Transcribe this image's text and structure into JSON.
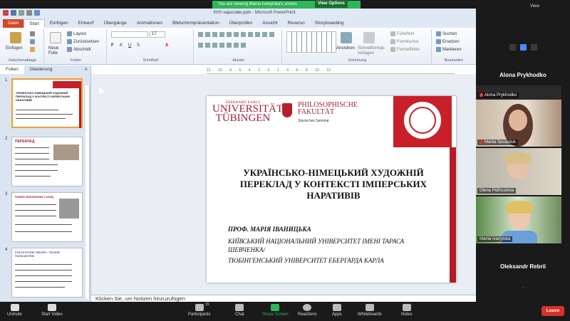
{
  "zoom": {
    "banner": "You are viewing Mariia Ivanytska's screen",
    "view_options": "View Options",
    "view": "View",
    "leave": "Leave",
    "toolbar": {
      "unmute": "Unmute",
      "start_video": "Start Video",
      "participants": "Participants",
      "participants_count": "15",
      "chat": "Chat",
      "share": "Share Screen",
      "reactions": "Reactions",
      "apps": "Apps",
      "whiteboards": "Whiteboards",
      "notes": "Notes"
    },
    "participants": {
      "header_name": "Alona Prykhodko",
      "tiles": [
        "Alona Prykhodko",
        "Mariia Sevastiuk",
        "Olena Pidhrushna",
        "Mariia Ivanytska"
      ],
      "footer_name": "Oleksandr Rebrii"
    }
  },
  "ppt": {
    "title": "КНУ-наративи.pptx - Microsoft PowerPoint",
    "tabs": [
      "Datei",
      "Start",
      "Einfügen",
      "Entwurf",
      "Übergänge",
      "Animationen",
      "Bildschirmpräsentation",
      "Überprüfen",
      "Ansicht",
      "Reverso",
      "Storyboarding"
    ],
    "ribbon": {
      "paste": "Einfügen",
      "clipboard": "Zwischenablage",
      "new_slide": "Neue\nFolie",
      "layout": "Layout",
      "reset": "Zurücksetzen",
      "section": "Abschnitt",
      "slides": "Folien",
      "font_size": "17",
      "font_group": "Schriftart",
      "paragraph": "Absatz",
      "arrange": "Anordnen",
      "quick_styles": "Schnellformat-\nvorlagen",
      "drawing": "Zeichnung",
      "fill": "Fülleffekt",
      "outline": "Formkontur",
      "effects": "Formeffekte",
      "find": "Suchen",
      "replace": "Ersetzen",
      "select": "Markieren",
      "editing": "Bearbeiten"
    },
    "pane_tabs": [
      "Folien",
      "Gliederung"
    ],
    "thumbs": [
      {
        "num": "1",
        "title": "УКРАЇНСЬКО-НІМЕЦЬКИЙ ХУДОЖНІЙ ПЕРЕКЛАД У КОНТЕКСТІ ІМПЕРСЬКИХ НАРАТИВІВ"
      },
      {
        "num": "2",
        "title": "ПЕРЕКЛАД"
      },
      {
        "num": "3",
        "title": "ПАВЛЕ ВИЕЛЬЕНКЕ (*1939)"
      },
      {
        "num": "4",
        "title": "POLYSYSTEM THEORY / ТЕОРІЯ ПОЛІСИСТЕМ"
      }
    ],
    "notes": "Klicken Sie, um Notizen hinzuzufügen",
    "slide": {
      "logo_small": "EBERHARD KARLS",
      "logo_big": "UNIVERSITÄT\nTÜBINGEN",
      "faculty": "PHILOSOPHISCHE\nFAKULTÄT",
      "seminar": "Slavisches Seminar",
      "title": "УКРАЇНСЬКО-НІМЕЦЬКИЙ ХУДОЖНІЙ ПЕРЕКЛАД У КОНТЕКСТІ ІМПЕРСЬКИХ НАРАТИВІВ",
      "author": "ПРОФ. МАРІЯ ІВАНИЦЬКА",
      "affil1": "КИЇВСЬКИЙ НАЦІОНАЛЬНИЙ УНІВЕРСИТЕТ ІМЕНІ ТАРАСА ШЕВЧЕНКА/",
      "affil2": "ТЮБІНГЕНСЬКИЙ УНІВЕРСИТЕТ ЕБЕРГАРДА КАРЛА"
    }
  },
  "colors": {
    "zoom_green": "#2fb55a",
    "ppt_file": "#d24726",
    "accent_red": "#b51c25"
  }
}
